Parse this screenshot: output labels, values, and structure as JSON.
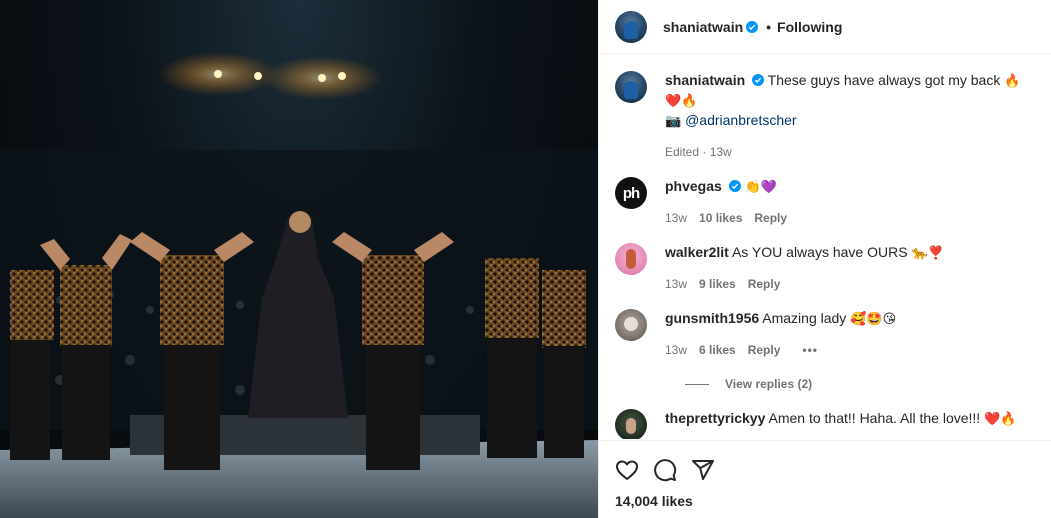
{
  "post": {
    "username": "shaniatwain",
    "follow_state": "Following",
    "separator": "•",
    "caption_text": "These guys have always got my back",
    "caption_emoji": "🔥❤️🔥",
    "camera_emoji": "📷",
    "mention": "@adrianbretscher",
    "edited": "Edited · 13w",
    "likes": "14,004 likes"
  },
  "comments": [
    {
      "username": "phvegas",
      "text": "",
      "emoji": "👏💜",
      "verified": true,
      "age": "13w",
      "likes": "10 likes",
      "reply": "Reply"
    },
    {
      "username": "walker2lit",
      "text": "As YOU always have OURS",
      "emoji": "🐆❣️",
      "verified": false,
      "age": "13w",
      "likes": "9 likes",
      "reply": "Reply"
    },
    {
      "username": "gunsmith1956",
      "text": "Amazing lady",
      "emoji": "🥰🤩😘",
      "verified": false,
      "age": "13w",
      "likes": "6 likes",
      "reply": "Reply",
      "more": "•••",
      "view_replies": "View replies (2)"
    },
    {
      "username": "theprettyrickyy",
      "text": "Amen to that!! Haha. All the love!!!",
      "emoji": "❤️🔥",
      "verified": false
    }
  ],
  "colors": {
    "verified": "#0095f6",
    "link": "#00376b",
    "muted": "#737373"
  },
  "icons": [
    "heart-icon",
    "comment-icon",
    "share-icon",
    "verified-icon",
    "ellipsis-icon"
  ]
}
